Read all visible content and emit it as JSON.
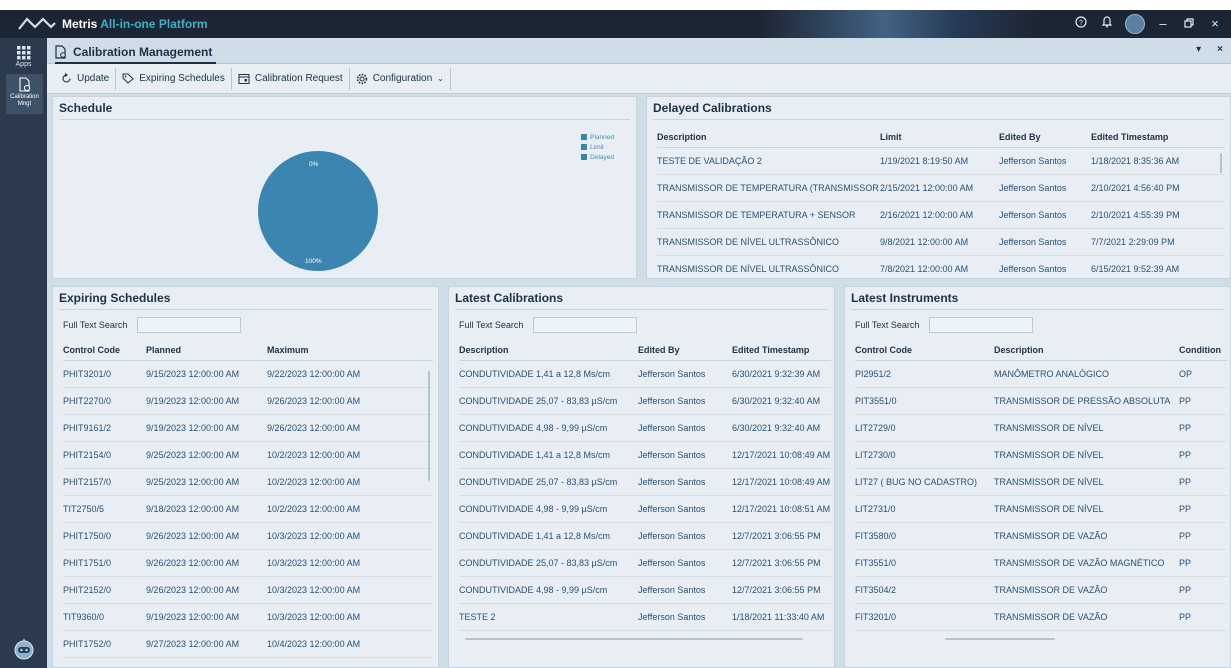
{
  "window": {
    "brand": "Metris",
    "title_accent": "All-in-one Platform",
    "icons": [
      "help-icon",
      "bell-icon",
      "user-avatar",
      "minimize-icon",
      "restore-icon",
      "close-icon"
    ]
  },
  "leftbar": {
    "apps_label": "Apps",
    "cal_label_1": "Calibration",
    "cal_label_2": "Mngt"
  },
  "tab": {
    "title": "Calibration Management",
    "pin": "▾",
    "close": "×"
  },
  "toolbar": {
    "update": "Update",
    "expiring": "Expiring Schedules",
    "request": "Calibration Request",
    "configuration": "Configuration"
  },
  "schedule": {
    "title": "Schedule",
    "legend": [
      "Planned",
      "Limit",
      "Delayed"
    ],
    "color": "#3b86b0"
  },
  "chart_data": {
    "type": "pie",
    "labels": [
      "Planned",
      "Limit",
      "Delayed"
    ],
    "values": [
      100,
      0,
      0
    ],
    "data_labels": [
      "100%",
      "0%"
    ],
    "legend_position": "top-right"
  },
  "delayed": {
    "title": "Delayed Calibrations",
    "columns": [
      "Description",
      "Limit",
      "Edited By",
      "Edited Timestamp"
    ],
    "rows": [
      [
        "TESTE DE VALIDAÇÃO 2",
        "1/19/2021 8:19:50 AM",
        "Jefferson Santos",
        "1/18/2021 8:35:36 AM"
      ],
      [
        "TRANSMISSOR DE TEMPERATURA (TRANSMISSOR",
        "2/15/2021 12:00:00 AM",
        "Jefferson Santos",
        "2/10/2021 4:56:40 PM"
      ],
      [
        "TRANSMISSOR DE TEMPERATURA + SENSOR",
        "2/16/2021 12:00:00 AM",
        "Jefferson Santos",
        "2/10/2021 4:55:39 PM"
      ],
      [
        "TRANSMISSOR DE NÍVEL ULTRASSÔNICO",
        "9/8/2021 12:00:00 AM",
        "Jefferson Santos",
        "7/7/2021 2:29:09 PM"
      ],
      [
        "TRANSMISSOR DE NÍVEL ULTRASSÔNICO",
        "7/8/2021 12:00:00 AM",
        "Jefferson Santos",
        "6/15/2021 9:52:39 AM"
      ]
    ]
  },
  "expiring": {
    "title": "Expiring Schedules",
    "search_label": "Full Text Search",
    "columns": [
      "Control Code",
      "Planned",
      "Maximum"
    ],
    "rows": [
      [
        "PHIT3201/0",
        "9/15/2023 12:00:00 AM",
        "9/22/2023 12:00:00 AM"
      ],
      [
        "PHIT2270/0",
        "9/19/2023 12:00:00 AM",
        "9/26/2023 12:00:00 AM"
      ],
      [
        "PHIT9161/2",
        "9/19/2023 12:00:00 AM",
        "9/26/2023 12:00:00 AM"
      ],
      [
        "PHIT2154/0",
        "9/25/2023 12:00:00 AM",
        "10/2/2023 12:00:00 AM"
      ],
      [
        "PHIT2157/0",
        "9/25/2023 12:00:00 AM",
        "10/2/2023 12:00:00 AM"
      ],
      [
        "TIT2750/5",
        "9/18/2023 12:00:00 AM",
        "10/2/2023 12:00:00 AM"
      ],
      [
        "PHIT1750/0",
        "9/26/2023 12:00:00 AM",
        "10/3/2023 12:00:00 AM"
      ],
      [
        "PHIT1751/0",
        "9/26/2023 12:00:00 AM",
        "10/3/2023 12:00:00 AM"
      ],
      [
        "PHIT2152/0",
        "9/26/2023 12:00:00 AM",
        "10/3/2023 12:00:00 AM"
      ],
      [
        "TIT9360/0",
        "9/19/2023 12:00:00 AM",
        "10/3/2023 12:00:00 AM"
      ],
      [
        "PHIT1752/0",
        "9/27/2023 12:00:00 AM",
        "10/4/2023 12:00:00 AM"
      ]
    ]
  },
  "latest_cal": {
    "title": "Latest Calibrations",
    "search_label": "Full Text Search",
    "columns": [
      "Description",
      "Edited By",
      "Edited Timestamp"
    ],
    "rows": [
      [
        "CONDUTIVIDADE 1,41 a 12,8 Ms/cm",
        "Jefferson Santos",
        "6/30/2021 9:32:39 AM"
      ],
      [
        "CONDUTIVIDADE 25,07 - 83,83 µS/cm",
        "Jefferson Santos",
        "6/30/2021 9:32:40 AM"
      ],
      [
        "CONDUTIVIDADE 4,98  - 9,99 µS/cm",
        "Jefferson Santos",
        "6/30/2021 9:32:40 AM"
      ],
      [
        "CONDUTIVIDADE 1,41 a 12,8 Ms/cm",
        "Jefferson Santos",
        "12/17/2021 10:08:49 AM"
      ],
      [
        "CONDUTIVIDADE 25,07 - 83,83 µS/cm",
        "Jefferson Santos",
        "12/17/2021 10:08:49 AM"
      ],
      [
        "CONDUTIVIDADE 4,98  - 9,99 µS/cm",
        "Jefferson Santos",
        "12/17/2021 10:08:51 AM"
      ],
      [
        "CONDUTIVIDADE 1,41 a 12,8 Ms/cm",
        "Jefferson Santos",
        "12/7/2021 3:06:55 PM"
      ],
      [
        "CONDUTIVIDADE 25,07 - 83,83 µS/cm",
        "Jefferson Santos",
        "12/7/2021 3:06:55 PM"
      ],
      [
        "CONDUTIVIDADE 4,98  - 9,99 µS/cm",
        "Jefferson Santos",
        "12/7/2021 3:06:55 PM"
      ],
      [
        "TESTE 2",
        "Jefferson Santos",
        "1/18/2021 11:33:40 AM"
      ]
    ]
  },
  "latest_inst": {
    "title": "Latest Instruments",
    "search_label": "Full Text Search",
    "columns": [
      "Control Code",
      "Description",
      "Condition"
    ],
    "rows": [
      [
        "PI2951/2",
        "MANÔMETRO ANALÓGICO",
        "OP"
      ],
      [
        "PIT3551/0",
        "TRANSMISSOR DE PRESSÃO ABSOLUTA",
        "PP"
      ],
      [
        "LIT2729/0",
        "TRANSMISSOR DE NÍVEL",
        "PP"
      ],
      [
        "LIT2730/0",
        "TRANSMISSOR DE NÍVEL",
        "PP"
      ],
      [
        "LIT27 ( BUG NO CADASTRO)",
        "TRANSMISSOR DE NÍVEL",
        "PP"
      ],
      [
        "LIT2731/0",
        "TRANSMISSOR DE NÍVEL",
        "PP"
      ],
      [
        "FIT3580/0",
        "TRANSMISSOR DE VAZÃO",
        "PP"
      ],
      [
        "FIT3551/0",
        "TRANSMISSOR DE VAZÃO MAGNÉTICO",
        "PP"
      ],
      [
        "FIT3504/2",
        "TRANSMISSOR DE VAZÃO",
        "PP"
      ],
      [
        "FIT3201/0",
        "TRANSMISSOR DE VAZÃO",
        "PP"
      ]
    ]
  }
}
